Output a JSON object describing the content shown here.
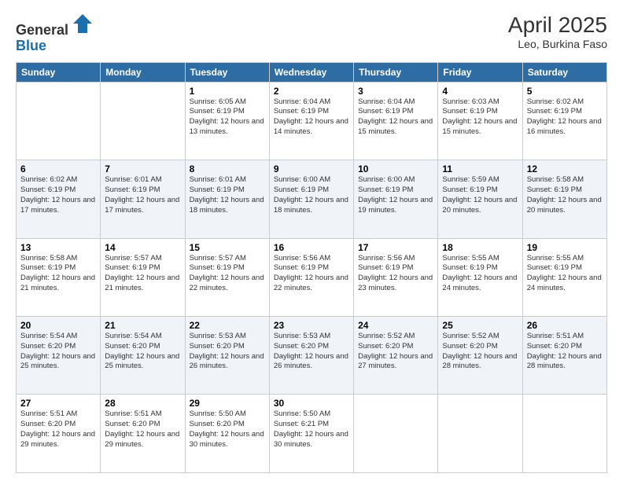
{
  "header": {
    "logo_line1": "General",
    "logo_line2": "Blue",
    "month": "April 2025",
    "location": "Leo, Burkina Faso"
  },
  "weekdays": [
    "Sunday",
    "Monday",
    "Tuesday",
    "Wednesday",
    "Thursday",
    "Friday",
    "Saturday"
  ],
  "rows": [
    {
      "style": "normal",
      "cells": [
        {
          "day": "",
          "info": ""
        },
        {
          "day": "",
          "info": ""
        },
        {
          "day": "1",
          "info": "Sunrise: 6:05 AM\nSunset: 6:19 PM\nDaylight: 12 hours and 13 minutes."
        },
        {
          "day": "2",
          "info": "Sunrise: 6:04 AM\nSunset: 6:19 PM\nDaylight: 12 hours and 14 minutes."
        },
        {
          "day": "3",
          "info": "Sunrise: 6:04 AM\nSunset: 6:19 PM\nDaylight: 12 hours and 15 minutes."
        },
        {
          "day": "4",
          "info": "Sunrise: 6:03 AM\nSunset: 6:19 PM\nDaylight: 12 hours and 15 minutes."
        },
        {
          "day": "5",
          "info": "Sunrise: 6:02 AM\nSunset: 6:19 PM\nDaylight: 12 hours and 16 minutes."
        }
      ]
    },
    {
      "style": "alt",
      "cells": [
        {
          "day": "6",
          "info": "Sunrise: 6:02 AM\nSunset: 6:19 PM\nDaylight: 12 hours and 17 minutes."
        },
        {
          "day": "7",
          "info": "Sunrise: 6:01 AM\nSunset: 6:19 PM\nDaylight: 12 hours and 17 minutes."
        },
        {
          "day": "8",
          "info": "Sunrise: 6:01 AM\nSunset: 6:19 PM\nDaylight: 12 hours and 18 minutes."
        },
        {
          "day": "9",
          "info": "Sunrise: 6:00 AM\nSunset: 6:19 PM\nDaylight: 12 hours and 18 minutes."
        },
        {
          "day": "10",
          "info": "Sunrise: 6:00 AM\nSunset: 6:19 PM\nDaylight: 12 hours and 19 minutes."
        },
        {
          "day": "11",
          "info": "Sunrise: 5:59 AM\nSunset: 6:19 PM\nDaylight: 12 hours and 20 minutes."
        },
        {
          "day": "12",
          "info": "Sunrise: 5:58 AM\nSunset: 6:19 PM\nDaylight: 12 hours and 20 minutes."
        }
      ]
    },
    {
      "style": "normal",
      "cells": [
        {
          "day": "13",
          "info": "Sunrise: 5:58 AM\nSunset: 6:19 PM\nDaylight: 12 hours and 21 minutes."
        },
        {
          "day": "14",
          "info": "Sunrise: 5:57 AM\nSunset: 6:19 PM\nDaylight: 12 hours and 21 minutes."
        },
        {
          "day": "15",
          "info": "Sunrise: 5:57 AM\nSunset: 6:19 PM\nDaylight: 12 hours and 22 minutes."
        },
        {
          "day": "16",
          "info": "Sunrise: 5:56 AM\nSunset: 6:19 PM\nDaylight: 12 hours and 22 minutes."
        },
        {
          "day": "17",
          "info": "Sunrise: 5:56 AM\nSunset: 6:19 PM\nDaylight: 12 hours and 23 minutes."
        },
        {
          "day": "18",
          "info": "Sunrise: 5:55 AM\nSunset: 6:19 PM\nDaylight: 12 hours and 24 minutes."
        },
        {
          "day": "19",
          "info": "Sunrise: 5:55 AM\nSunset: 6:19 PM\nDaylight: 12 hours and 24 minutes."
        }
      ]
    },
    {
      "style": "alt",
      "cells": [
        {
          "day": "20",
          "info": "Sunrise: 5:54 AM\nSunset: 6:20 PM\nDaylight: 12 hours and 25 minutes."
        },
        {
          "day": "21",
          "info": "Sunrise: 5:54 AM\nSunset: 6:20 PM\nDaylight: 12 hours and 25 minutes."
        },
        {
          "day": "22",
          "info": "Sunrise: 5:53 AM\nSunset: 6:20 PM\nDaylight: 12 hours and 26 minutes."
        },
        {
          "day": "23",
          "info": "Sunrise: 5:53 AM\nSunset: 6:20 PM\nDaylight: 12 hours and 26 minutes."
        },
        {
          "day": "24",
          "info": "Sunrise: 5:52 AM\nSunset: 6:20 PM\nDaylight: 12 hours and 27 minutes."
        },
        {
          "day": "25",
          "info": "Sunrise: 5:52 AM\nSunset: 6:20 PM\nDaylight: 12 hours and 28 minutes."
        },
        {
          "day": "26",
          "info": "Sunrise: 5:51 AM\nSunset: 6:20 PM\nDaylight: 12 hours and 28 minutes."
        }
      ]
    },
    {
      "style": "normal",
      "cells": [
        {
          "day": "27",
          "info": "Sunrise: 5:51 AM\nSunset: 6:20 PM\nDaylight: 12 hours and 29 minutes."
        },
        {
          "day": "28",
          "info": "Sunrise: 5:51 AM\nSunset: 6:20 PM\nDaylight: 12 hours and 29 minutes."
        },
        {
          "day": "29",
          "info": "Sunrise: 5:50 AM\nSunset: 6:20 PM\nDaylight: 12 hours and 30 minutes."
        },
        {
          "day": "30",
          "info": "Sunrise: 5:50 AM\nSunset: 6:21 PM\nDaylight: 12 hours and 30 minutes."
        },
        {
          "day": "",
          "info": ""
        },
        {
          "day": "",
          "info": ""
        },
        {
          "day": "",
          "info": ""
        }
      ]
    }
  ]
}
